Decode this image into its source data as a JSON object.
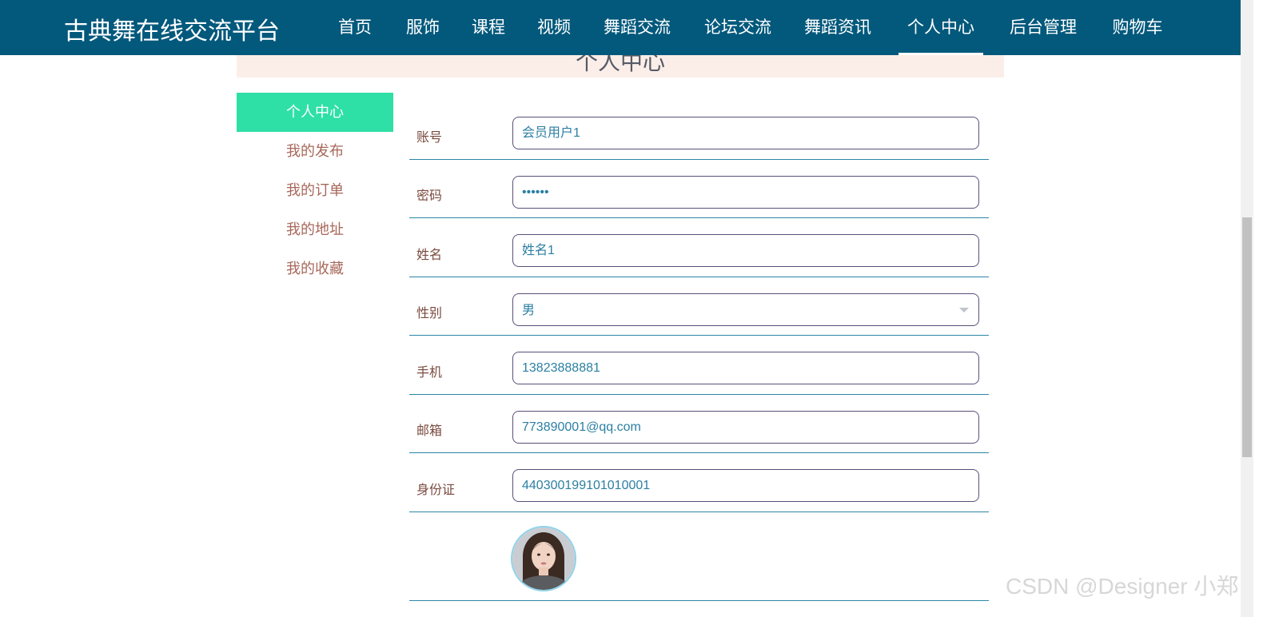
{
  "header": {
    "brand": "古典舞在线交流平台",
    "nav": [
      {
        "label": "首页"
      },
      {
        "label": "服饰"
      },
      {
        "label": "课程"
      },
      {
        "label": "视频"
      },
      {
        "label": "舞蹈交流"
      },
      {
        "label": "论坛交流"
      },
      {
        "label": "舞蹈资讯"
      },
      {
        "label": "个人中心",
        "active": true
      },
      {
        "label": "后台管理"
      },
      {
        "label": "购物车"
      }
    ]
  },
  "page_title": "个人中心",
  "sidebar": {
    "items": [
      {
        "label": "个人中心",
        "active": true
      },
      {
        "label": "我的发布"
      },
      {
        "label": "我的订单"
      },
      {
        "label": "我的地址"
      },
      {
        "label": "我的收藏"
      }
    ]
  },
  "form": {
    "account": {
      "label": "账号",
      "value": "会员用户1"
    },
    "password": {
      "label": "密码",
      "value": "••••••"
    },
    "name": {
      "label": "姓名",
      "value": "姓名1"
    },
    "gender": {
      "label": "性别",
      "value": "男"
    },
    "phone": {
      "label": "手机",
      "value": "13823888881"
    },
    "email": {
      "label": "邮箱",
      "value": "773890001@qq.com"
    },
    "id_card": {
      "label": "身份证",
      "value": "440300199101010001"
    },
    "avatar": {
      "icon": "user-avatar-photo"
    }
  },
  "watermark": "CSDN @Designer 小郑",
  "colors": {
    "nav_bg": "#03597c",
    "sidebar_active": "#2ee0a5",
    "sidebar_text": "#a8675a",
    "title_bg": "#fbeee8",
    "input_text": "#2c7fa3",
    "row_divider": "#2b86a6"
  }
}
